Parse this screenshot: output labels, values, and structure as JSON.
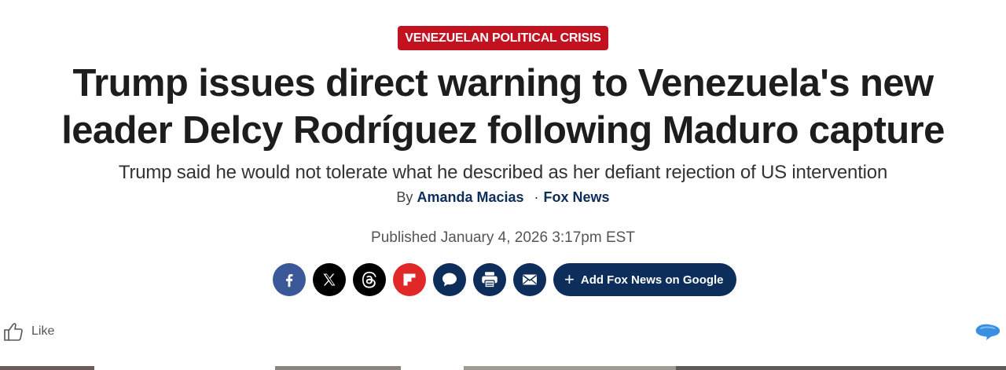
{
  "eyebrow": "VENEZUELAN POLITICAL CRISIS",
  "headline": "Trump issues direct warning to Venezuela's new leader Delcy Rodríguez following Maduro capture",
  "subhead": "Trump said he would not tolerate what he described as her defiant rejection of US intervention",
  "byline": {
    "prefix": "By",
    "author": "Amanda Macias",
    "separator": "·",
    "outlet": "Fox News"
  },
  "published": "Published January 4, 2026 3:17pm EST",
  "share": {
    "buttons": [
      {
        "name": "facebook",
        "icon": "facebook-icon"
      },
      {
        "name": "x",
        "icon": "x-icon"
      },
      {
        "name": "threads",
        "icon": "threads-icon"
      },
      {
        "name": "flipboard",
        "icon": "flipboard-icon"
      },
      {
        "name": "comments",
        "icon": "comment-icon"
      },
      {
        "name": "print",
        "icon": "print-icon"
      },
      {
        "name": "email",
        "icon": "email-icon"
      }
    ],
    "google_label": "Add Fox News on Google"
  },
  "like": {
    "label": "Like",
    "icon": "thumbs-up-icon"
  },
  "colors": {
    "eyebrow_bg": "#c2121f",
    "brand_navy": "#0d2d5b",
    "facebook": "#3b5998",
    "flipboard": "#e12828"
  }
}
